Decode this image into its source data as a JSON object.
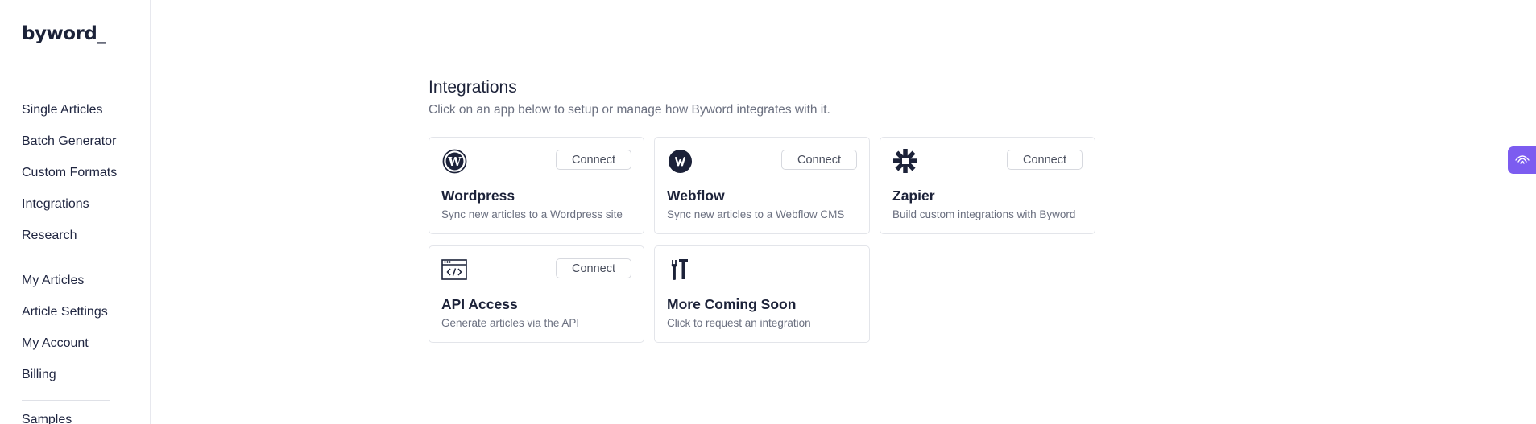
{
  "app": {
    "logo": "byword_"
  },
  "sidebar": {
    "group1": [
      {
        "label": "Single Articles"
      },
      {
        "label": "Batch Generator"
      },
      {
        "label": "Custom Formats"
      },
      {
        "label": "Integrations"
      },
      {
        "label": "Research"
      }
    ],
    "group2": [
      {
        "label": "My Articles"
      },
      {
        "label": "Article Settings"
      },
      {
        "label": "My Account"
      },
      {
        "label": "Billing"
      }
    ],
    "group3": [
      {
        "label": "Samples"
      }
    ]
  },
  "main": {
    "title": "Integrations",
    "subtitle": "Click on an app below to setup or manage how Byword integrates with it.",
    "cards": [
      {
        "icon": "wordpress-icon",
        "title": "Wordpress",
        "desc": "Sync new articles to a Wordpress site",
        "button": "Connect"
      },
      {
        "icon": "webflow-icon",
        "title": "Webflow",
        "desc": "Sync new articles to a Webflow CMS",
        "button": "Connect"
      },
      {
        "icon": "zapier-icon",
        "title": "Zapier",
        "desc": "Build custom integrations with Byword",
        "button": "Connect"
      },
      {
        "icon": "code-window-icon",
        "title": "API Access",
        "desc": "Generate articles via the API",
        "button": "Connect"
      },
      {
        "icon": "tools-icon",
        "title": "More Coming Soon",
        "desc": "Click to request an integration"
      }
    ]
  },
  "colors": {
    "accent": "#7c5cf0",
    "text": "#1c2239",
    "muted": "#6b7080"
  }
}
